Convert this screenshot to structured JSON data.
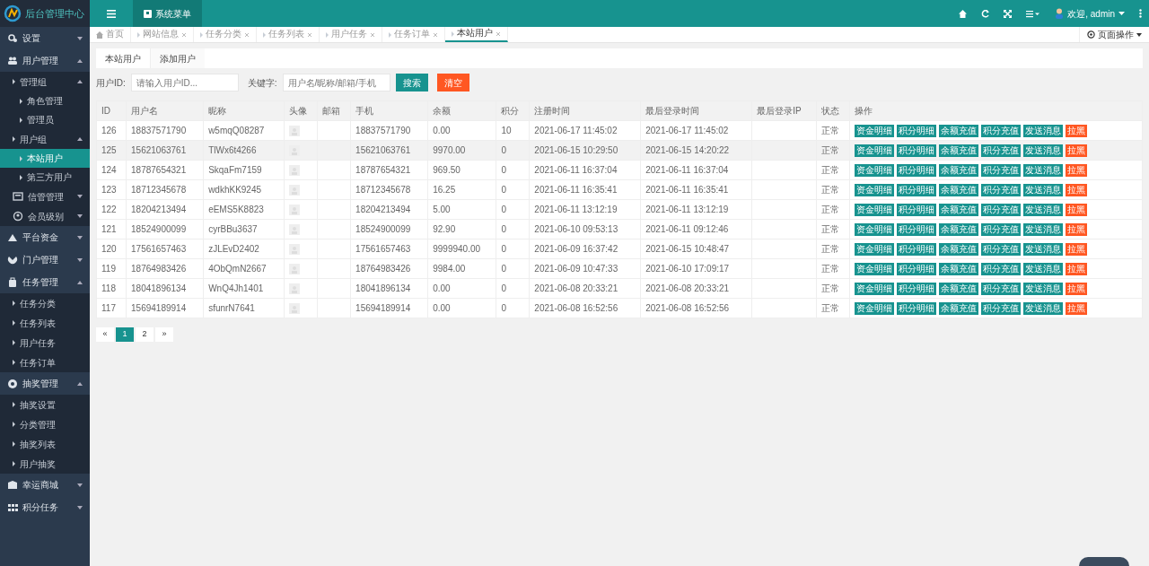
{
  "brand": {
    "title": "后台管理中心"
  },
  "topbar": {
    "menu_tab": {
      "label": "系统菜单",
      "selected": true
    },
    "user": "欢迎, admin"
  },
  "sidebar": {
    "items": [
      {
        "label": "设置",
        "expanded": false
      },
      {
        "label": "用户管理",
        "expanded": true,
        "children": [
          {
            "label": "管理组",
            "expanded": true,
            "children": [
              {
                "label": "角色管理",
                "selected": false
              },
              {
                "label": "管理员",
                "selected": false
              }
            ]
          },
          {
            "label": "用户组",
            "expanded": true,
            "children": [
              {
                "label": "本站用户",
                "selected": true
              },
              {
                "label": "第三方用户",
                "selected": false
              }
            ]
          },
          {
            "label": "信管管理",
            "expanded": false
          },
          {
            "label": "会员级别",
            "expanded": false
          }
        ]
      },
      {
        "label": "平台资金",
        "expanded": false
      },
      {
        "label": "门户管理",
        "expanded": false
      },
      {
        "label": "任务管理",
        "expanded": true,
        "children": [
          {
            "label": "任务分类",
            "selected": false
          },
          {
            "label": "任务列表",
            "selected": false
          },
          {
            "label": "用户任务",
            "selected": false
          },
          {
            "label": "任务订单",
            "selected": false
          }
        ]
      },
      {
        "label": "抽奖管理",
        "expanded": true,
        "children": [
          {
            "label": "抽奖设置",
            "selected": false
          },
          {
            "label": "分类管理",
            "selected": false
          },
          {
            "label": "抽奖列表",
            "selected": false
          },
          {
            "label": "用户抽奖",
            "selected": false
          }
        ]
      },
      {
        "label": "幸运商城",
        "expanded": false
      },
      {
        "label": "积分任务",
        "expanded": false
      }
    ]
  },
  "page_tabs": [
    {
      "label": "首页",
      "kind": "home",
      "selected": false
    },
    {
      "label": "网站信息",
      "kind": "closable",
      "selected": false
    },
    {
      "label": "任务分类",
      "kind": "closable",
      "selected": false
    },
    {
      "label": "任务列表",
      "kind": "closable",
      "selected": false
    },
    {
      "label": "用户任务",
      "kind": "closable",
      "selected": false
    },
    {
      "label": "任务订单",
      "kind": "closable",
      "selected": false
    },
    {
      "label": "本站用户",
      "kind": "closable",
      "selected": true
    }
  ],
  "page_actions": "页面操作",
  "sub_tabs": [
    {
      "label": "本站用户",
      "selected": true
    },
    {
      "label": "添加用户",
      "selected": false
    }
  ],
  "filter": {
    "id_label": "用户ID:",
    "id_placeholder": "请输入用户ID...",
    "keyword_label": "关键字:",
    "keyword_placeholder": "用户名/昵称/邮箱/手机",
    "search": "搜索",
    "clear": "清空"
  },
  "table": {
    "columns": [
      "ID",
      "用户名",
      "昵称",
      "头像",
      "邮箱",
      "手机",
      "余额",
      "积分",
      "注册时间",
      "最后登录时间",
      "最后登录IP",
      "状态",
      "操作"
    ],
    "rows": [
      {
        "hovered": false,
        "cells": [
          "126",
          "18837571790",
          "w5mqQ08287",
          "",
          "",
          "18837571790",
          "0.00",
          "10",
          "2021-06-17 11:45:02",
          "2021-06-17 11:45:02",
          "",
          "正常"
        ],
        "actions": [
          {
            "label": "资金明细",
            "kind": "primary"
          },
          {
            "label": "积分明细",
            "kind": "primary"
          },
          {
            "label": "余额充值",
            "kind": "primary"
          },
          {
            "label": "积分充值",
            "kind": "primary"
          },
          {
            "label": "发送消息",
            "kind": "primary"
          },
          {
            "label": "拉黑",
            "kind": "danger"
          }
        ]
      },
      {
        "hovered": true,
        "cells": [
          "125",
          "15621063761",
          "TlWx6t4266",
          "",
          "",
          "15621063761",
          "9970.00",
          "0",
          "2021-06-15 10:29:50",
          "2021-06-15 14:20:22",
          "",
          "正常"
        ],
        "actions": [
          {
            "label": "资金明细",
            "kind": "primary"
          },
          {
            "label": "积分明细",
            "kind": "primary"
          },
          {
            "label": "余额充值",
            "kind": "primary"
          },
          {
            "label": "积分充值",
            "kind": "primary"
          },
          {
            "label": "发送消息",
            "kind": "primary"
          },
          {
            "label": "拉黑",
            "kind": "danger"
          }
        ]
      },
      {
        "hovered": false,
        "cells": [
          "124",
          "18787654321",
          "SkqaFm7159",
          "",
          "",
          "18787654321",
          "969.50",
          "0",
          "2021-06-11 16:37:04",
          "2021-06-11 16:37:04",
          "",
          "正常"
        ],
        "actions": [
          {
            "label": "资金明细",
            "kind": "primary"
          },
          {
            "label": "积分明细",
            "kind": "primary"
          },
          {
            "label": "余额充值",
            "kind": "primary"
          },
          {
            "label": "积分充值",
            "kind": "primary"
          },
          {
            "label": "发送消息",
            "kind": "primary"
          },
          {
            "label": "拉黑",
            "kind": "danger"
          }
        ]
      },
      {
        "hovered": false,
        "cells": [
          "123",
          "18712345678",
          "wdkhKK9245",
          "",
          "",
          "18712345678",
          "16.25",
          "0",
          "2021-06-11 16:35:41",
          "2021-06-11 16:35:41",
          "",
          "正常"
        ],
        "actions": [
          {
            "label": "资金明细",
            "kind": "primary"
          },
          {
            "label": "积分明细",
            "kind": "primary"
          },
          {
            "label": "余额充值",
            "kind": "primary"
          },
          {
            "label": "积分充值",
            "kind": "primary"
          },
          {
            "label": "发送消息",
            "kind": "primary"
          },
          {
            "label": "拉黑",
            "kind": "danger"
          }
        ]
      },
      {
        "hovered": false,
        "cells": [
          "122",
          "18204213494",
          "eEMS5K8823",
          "",
          "",
          "18204213494",
          "5.00",
          "0",
          "2021-06-11 13:12:19",
          "2021-06-11 13:12:19",
          "",
          "正常"
        ],
        "actions": [
          {
            "label": "资金明细",
            "kind": "primary"
          },
          {
            "label": "积分明细",
            "kind": "primary"
          },
          {
            "label": "余额充值",
            "kind": "primary"
          },
          {
            "label": "积分充值",
            "kind": "primary"
          },
          {
            "label": "发送消息",
            "kind": "primary"
          },
          {
            "label": "拉黑",
            "kind": "danger"
          }
        ]
      },
      {
        "hovered": false,
        "cells": [
          "121",
          "18524900099",
          "cyrBBu3637",
          "",
          "",
          "18524900099",
          "92.90",
          "0",
          "2021-06-10 09:53:13",
          "2021-06-11 09:12:46",
          "",
          "正常"
        ],
        "actions": [
          {
            "label": "资金明细",
            "kind": "primary"
          },
          {
            "label": "积分明细",
            "kind": "primary"
          },
          {
            "label": "余额充值",
            "kind": "primary"
          },
          {
            "label": "积分充值",
            "kind": "primary"
          },
          {
            "label": "发送消息",
            "kind": "primary"
          },
          {
            "label": "拉黑",
            "kind": "danger"
          }
        ]
      },
      {
        "hovered": false,
        "cells": [
          "120",
          "17561657463",
          "zJLEvD2402",
          "",
          "",
          "17561657463",
          "9999940.00",
          "0",
          "2021-06-09 16:37:42",
          "2021-06-15 10:48:47",
          "",
          "正常"
        ],
        "actions": [
          {
            "label": "资金明细",
            "kind": "primary"
          },
          {
            "label": "积分明细",
            "kind": "primary"
          },
          {
            "label": "余额充值",
            "kind": "primary"
          },
          {
            "label": "积分充值",
            "kind": "primary"
          },
          {
            "label": "发送消息",
            "kind": "primary"
          },
          {
            "label": "拉黑",
            "kind": "danger"
          }
        ]
      },
      {
        "hovered": false,
        "cells": [
          "119",
          "18764983426",
          "4ObQmN2667",
          "",
          "",
          "18764983426",
          "9984.00",
          "0",
          "2021-06-09 10:47:33",
          "2021-06-10 17:09:17",
          "",
          "正常"
        ],
        "actions": [
          {
            "label": "资金明细",
            "kind": "primary"
          },
          {
            "label": "积分明细",
            "kind": "primary"
          },
          {
            "label": "余额充值",
            "kind": "primary"
          },
          {
            "label": "积分充值",
            "kind": "primary"
          },
          {
            "label": "发送消息",
            "kind": "primary"
          },
          {
            "label": "拉黑",
            "kind": "danger"
          }
        ]
      },
      {
        "hovered": false,
        "cells": [
          "118",
          "18041896134",
          "WnQ4Jh1401",
          "",
          "",
          "18041896134",
          "0.00",
          "0",
          "2021-06-08 20:33:21",
          "2021-06-08 20:33:21",
          "",
          "正常"
        ],
        "actions": [
          {
            "label": "资金明细",
            "kind": "primary"
          },
          {
            "label": "积分明细",
            "kind": "primary"
          },
          {
            "label": "余额充值",
            "kind": "primary"
          },
          {
            "label": "积分充值",
            "kind": "primary"
          },
          {
            "label": "发送消息",
            "kind": "primary"
          },
          {
            "label": "拉黑",
            "kind": "danger"
          }
        ]
      },
      {
        "hovered": false,
        "cells": [
          "117",
          "15694189914",
          "sfunrN7641",
          "",
          "",
          "15694189914",
          "0.00",
          "0",
          "2021-06-08 16:52:56",
          "2021-06-08 16:52:56",
          "",
          "正常"
        ],
        "actions": [
          {
            "label": "资金明细",
            "kind": "primary"
          },
          {
            "label": "积分明细",
            "kind": "primary"
          },
          {
            "label": "余额充值",
            "kind": "primary"
          },
          {
            "label": "积分充值",
            "kind": "primary"
          },
          {
            "label": "发送消息",
            "kind": "primary"
          },
          {
            "label": "拉黑",
            "kind": "danger"
          }
        ]
      }
    ]
  },
  "pagination": [
    {
      "label": "«",
      "selected": false
    },
    {
      "label": "1",
      "selected": true
    },
    {
      "label": "2",
      "selected": false
    },
    {
      "label": "»",
      "selected": false
    }
  ]
}
